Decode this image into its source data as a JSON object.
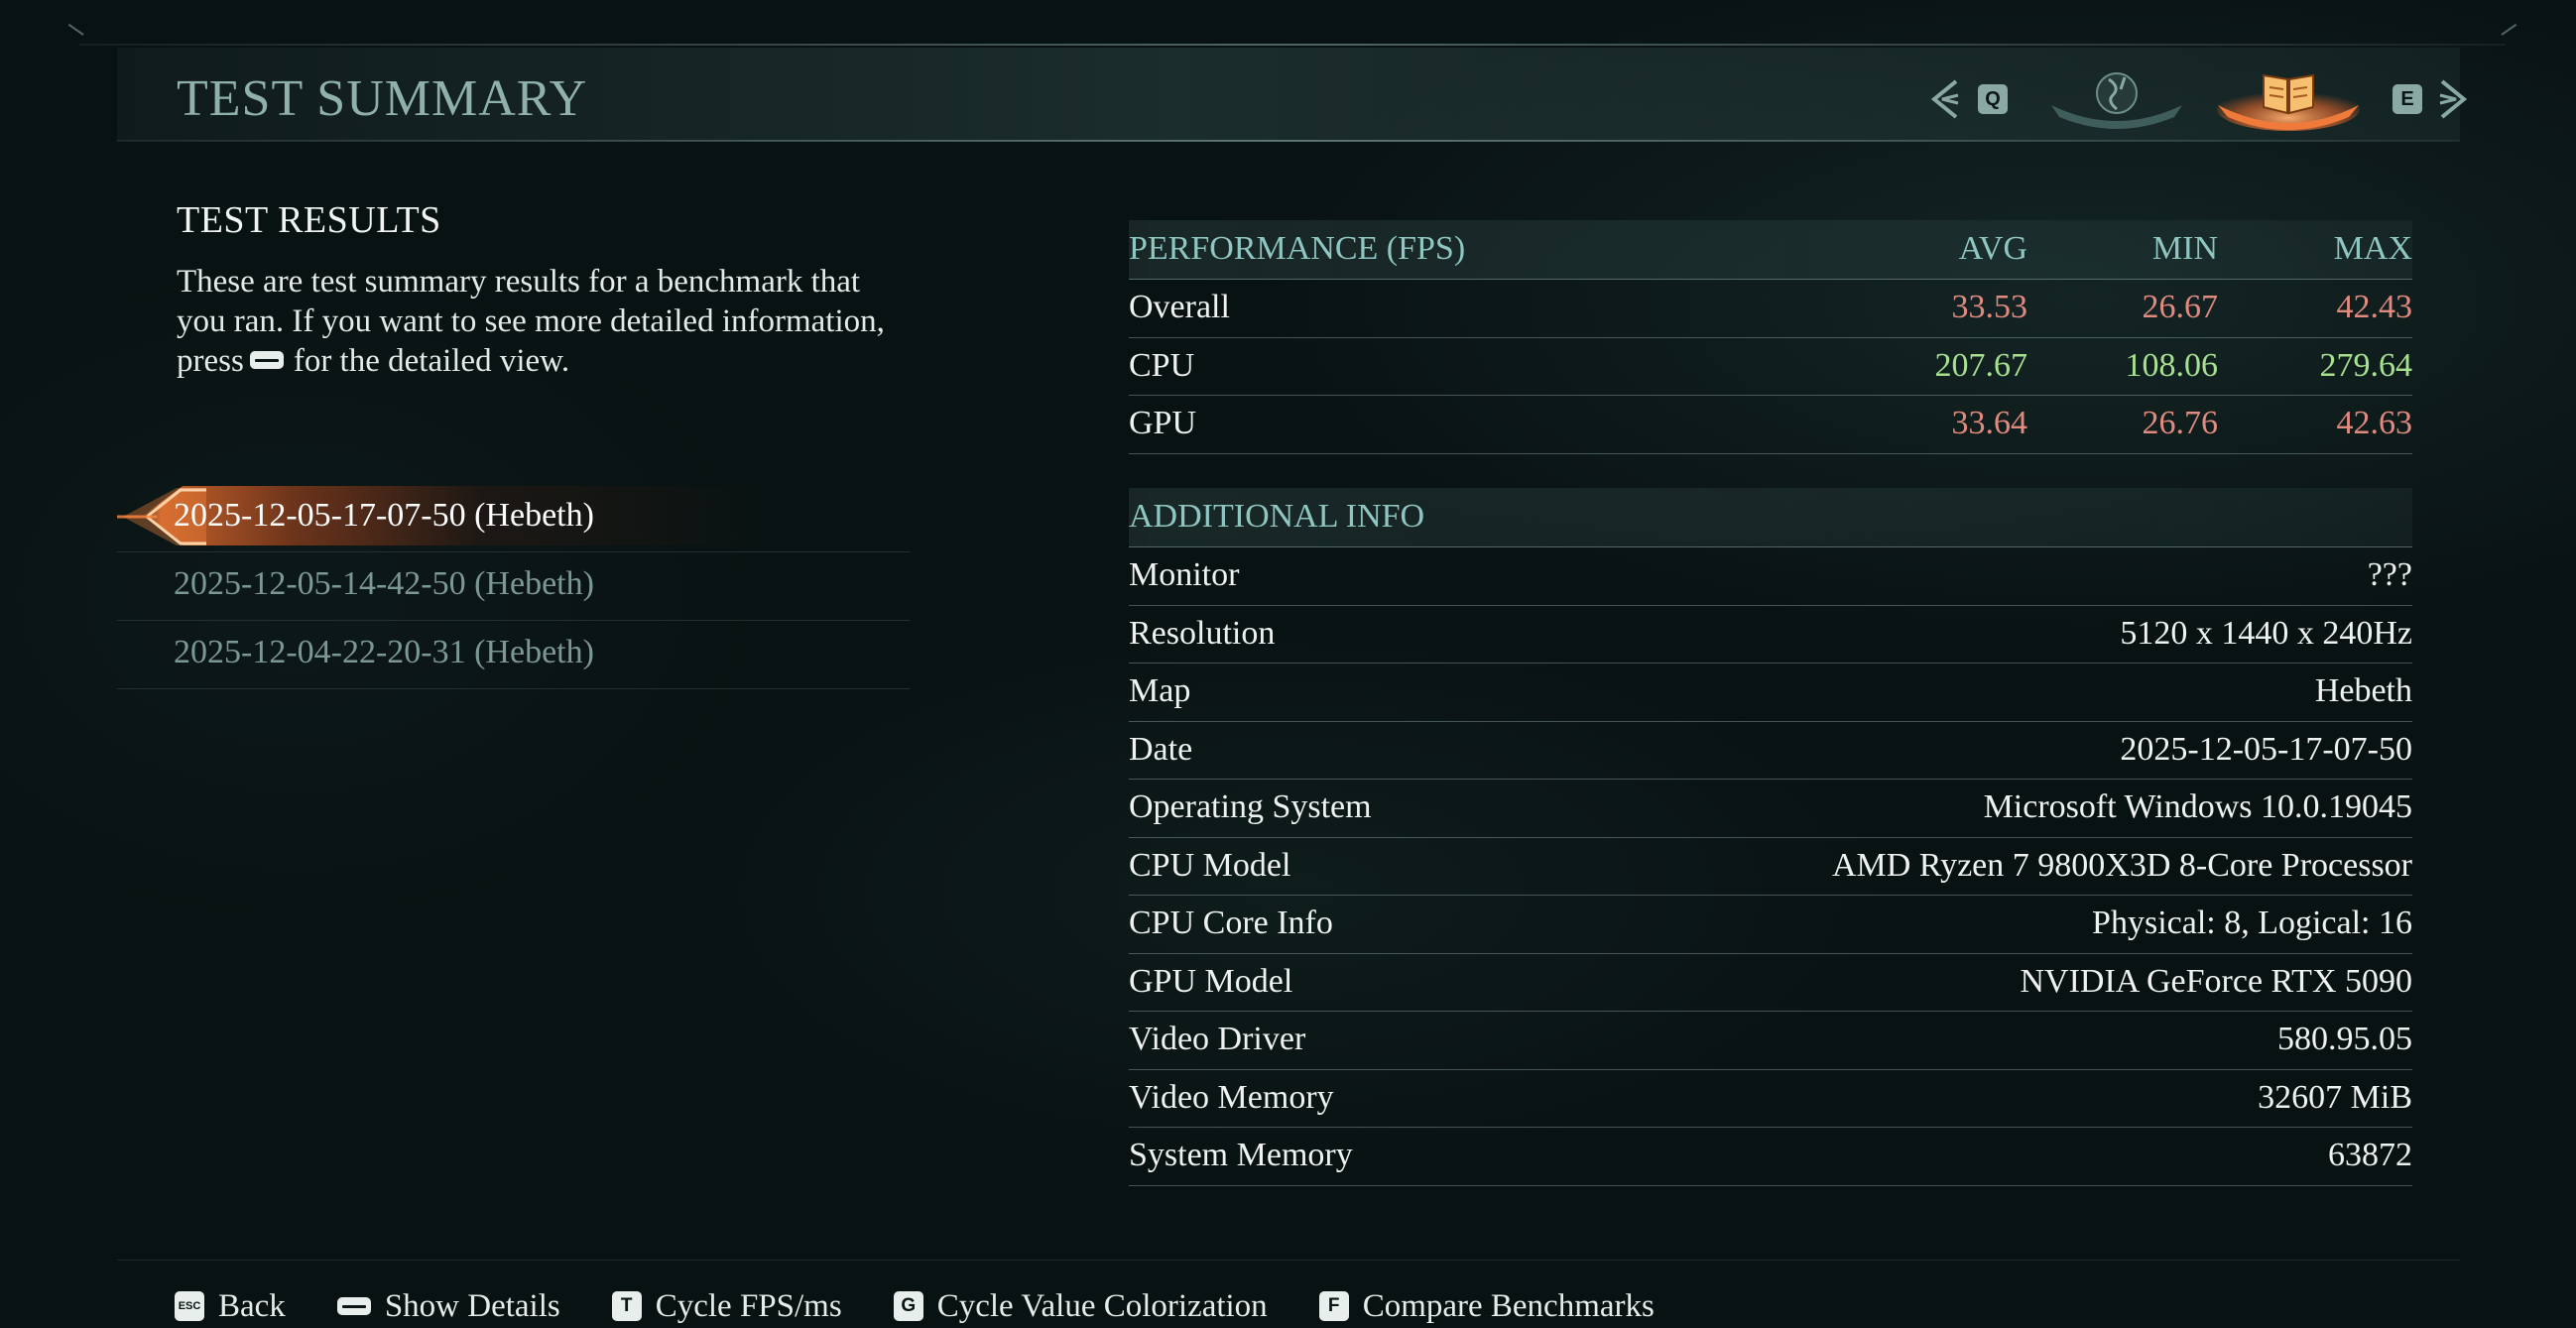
{
  "header": {
    "title": "TEST SUMMARY",
    "prev_key": "Q",
    "next_key": "E",
    "tabs": [
      {
        "icon": "globe-icon",
        "active": false
      },
      {
        "icon": "book-icon",
        "active": true
      }
    ]
  },
  "left": {
    "section_title": "TEST RESULTS",
    "description_lines": [
      "These are test summary results for a benchmark that",
      "you ran. If you want to see more detailed information,"
    ],
    "description_press": "press",
    "description_tail": "for the detailed view.",
    "history": [
      {
        "label": "2025-12-05-17-07-50 (Hebeth)",
        "selected": true
      },
      {
        "label": "2025-12-05-14-42-50 (Hebeth)",
        "selected": false
      },
      {
        "label": "2025-12-04-22-20-31 (Hebeth)",
        "selected": false
      }
    ]
  },
  "performance": {
    "title": "PERFORMANCE (FPS)",
    "columns": [
      "AVG",
      "MIN",
      "MAX"
    ],
    "rows": [
      {
        "label": "Overall",
        "avg": "33.53",
        "min": "26.67",
        "max": "42.43",
        "tone": "bad"
      },
      {
        "label": "CPU",
        "avg": "207.67",
        "min": "108.06",
        "max": "279.64",
        "tone": "good"
      },
      {
        "label": "GPU",
        "avg": "33.64",
        "min": "26.76",
        "max": "42.63",
        "tone": "bad"
      }
    ],
    "colors": {
      "bad": "#e08a80",
      "good": "#a7e090"
    }
  },
  "additional": {
    "title": "ADDITIONAL INFO",
    "rows": [
      {
        "label": "Monitor",
        "value": "???"
      },
      {
        "label": "Resolution",
        "value": "5120 x 1440 x 240Hz"
      },
      {
        "label": "Map",
        "value": "Hebeth"
      },
      {
        "label": "Date",
        "value": "2025-12-05-17-07-50"
      },
      {
        "label": "Operating System",
        "value": "Microsoft Windows 10.0.19045"
      },
      {
        "label": "CPU Model",
        "value": "AMD Ryzen 7 9800X3D 8-Core Processor"
      },
      {
        "label": "CPU Core Info",
        "value": "Physical: 8, Logical: 16"
      },
      {
        "label": "GPU Model",
        "value": "NVIDIA GeForce RTX 5090"
      },
      {
        "label": "Video Driver",
        "value": "580.95.05"
      },
      {
        "label": "Video Memory",
        "value": "32607 MiB"
      },
      {
        "label": "System Memory",
        "value": "63872"
      }
    ]
  },
  "footer": {
    "hints": [
      {
        "key": "ESC",
        "label": "Back",
        "name": "back"
      },
      {
        "key": "",
        "label": "Show Details",
        "name": "show-details"
      },
      {
        "key": "T",
        "label": "Cycle FPS/ms",
        "name": "cycle-fps-ms"
      },
      {
        "key": "G",
        "label": "Cycle Value Colorization",
        "name": "cycle-value-colorization"
      },
      {
        "key": "F",
        "label": "Compare Benchmarks",
        "name": "compare-benchmarks"
      }
    ]
  }
}
